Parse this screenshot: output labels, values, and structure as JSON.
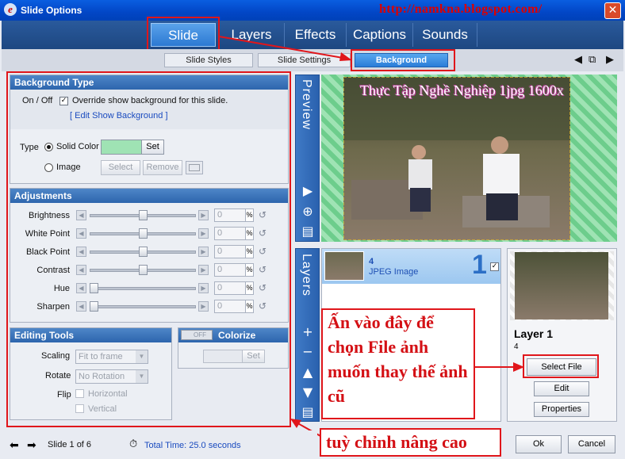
{
  "window": {
    "title": "Slide Options",
    "watermark_url": "http://namkna.blogspot.com/",
    "close": "✕"
  },
  "main_tabs": [
    "Slide",
    "Layers",
    "Effects",
    "Captions",
    "Sounds"
  ],
  "sub_tabs": [
    "Slide Styles",
    "Slide Settings",
    "Background"
  ],
  "nav_icons": {
    "left": "◀",
    "mid": "⧉",
    "right": "▶"
  },
  "background_type": {
    "header": "Background Type",
    "onoff_label": "On / Off",
    "override_text": "Override show background for this slide.",
    "override_checked": true,
    "edit_link": "[ Edit Show Background ]",
    "type_label": "Type",
    "solid_label": "Solid Color",
    "solid_color": "#9fe3b4",
    "set_label": "Set",
    "image_label": "Image",
    "select_label": "Select",
    "remove_label": "Remove",
    "selected_type": "solid"
  },
  "adjustments": {
    "header": "Adjustments",
    "rows": [
      {
        "label": "Brightness",
        "value": "0",
        "level": 0.5
      },
      {
        "label": "White Point",
        "value": "0",
        "level": 0.5
      },
      {
        "label": "Black Point",
        "value": "0",
        "level": 0.5
      },
      {
        "label": "Contrast",
        "value": "0",
        "level": 0.5
      },
      {
        "label": "Hue",
        "value": "0",
        "level": 0
      },
      {
        "label": "Sharpen",
        "value": "0",
        "level": 0
      }
    ],
    "unit": "%"
  },
  "editing_tools": {
    "header": "Editing Tools",
    "scaling_label": "Scaling",
    "scaling_value": "Fit to frame",
    "rotate_label": "Rotate",
    "rotate_value": "No Rotation",
    "flip_label": "Flip",
    "horizontal_label": "Horizontal",
    "vertical_label": "Vertical"
  },
  "colorize": {
    "header": "Colorize",
    "toggle": "OFF",
    "set_label": "Set"
  },
  "preview": {
    "label": "Preview",
    "overlay_caption": "Thực Tập Nghề Nghiệp 1jpg 1600x"
  },
  "layers": {
    "label": "Layers",
    "item": {
      "number": "4",
      "type": "JPEG Image",
      "index": "1",
      "checked": true
    }
  },
  "layer_detail": {
    "name": "Layer 1",
    "number": "4",
    "select_file": "Select File",
    "edit": "Edit",
    "properties": "Properties"
  },
  "annotations": {
    "select_hint": "Ấn vào đây để chọn File ảnh muốn thay thế ảnh cũ",
    "advanced": "tuỳ chỉnh nâng cao"
  },
  "footer": {
    "slide_of": "Slide 1 of 6",
    "total_time": "Total Time: 25.0 seconds",
    "ok": "Ok",
    "cancel": "Cancel"
  },
  "colors": {
    "accent": "#2c79d2",
    "annotation_red": "#e0161b",
    "background_green": "#9fe3b4"
  }
}
